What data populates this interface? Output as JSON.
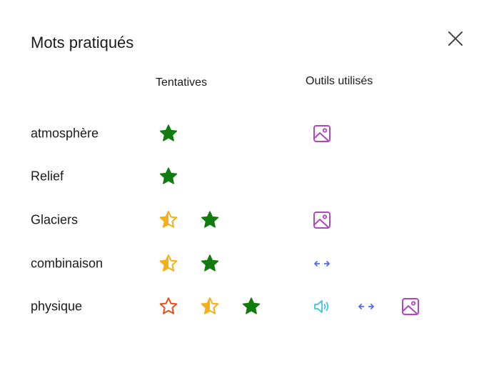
{
  "dialog": {
    "title": "Mots pratiqués",
    "close_icon": "close-icon"
  },
  "columns": {
    "attempts": "Tentatives",
    "tools": "Outils utilisés"
  },
  "colors": {
    "star_full": "#107c10",
    "star_partial": "#f3b019",
    "star_empty": "#e8501e",
    "picture_dictionary": "#b146c2",
    "syllables": "#4f6bed",
    "read_aloud": "#3cc6d8"
  },
  "rows": [
    {
      "word": "atmosphère",
      "attempts": [
        "star-full"
      ],
      "tools": [
        "picture-dictionary-icon"
      ]
    },
    {
      "word": "Relief",
      "attempts": [
        "star-full"
      ],
      "tools": []
    },
    {
      "word": "Glaciers",
      "attempts": [
        "star-partial",
        "star-full"
      ],
      "tools": [
        "picture-dictionary-icon"
      ]
    },
    {
      "word": "combinaison",
      "attempts": [
        "star-partial",
        "star-full"
      ],
      "tools": [
        "syllables-icon"
      ]
    },
    {
      "word": "physique",
      "attempts": [
        "star-empty",
        "star-partial",
        "star-full"
      ],
      "tools": [
        "read-aloud-icon",
        "syllables-icon",
        "picture-dictionary-icon"
      ]
    }
  ]
}
